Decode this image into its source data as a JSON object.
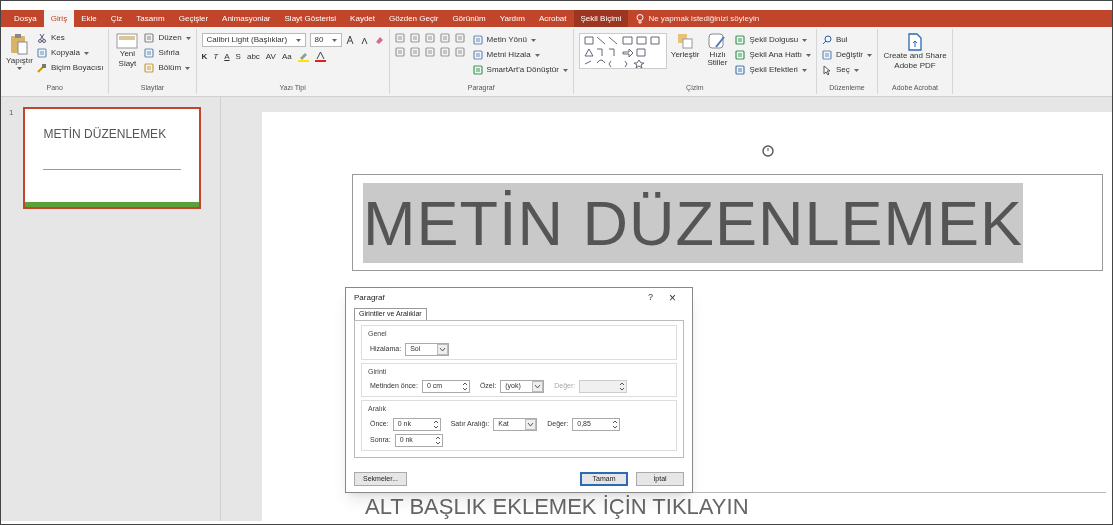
{
  "tabs": [
    {
      "label": "Dosya",
      "selected": false,
      "kind": "normal"
    },
    {
      "label": "Giriş",
      "selected": true,
      "kind": "normal"
    },
    {
      "label": "Ekle",
      "selected": false,
      "kind": "normal"
    },
    {
      "label": "Çiz",
      "selected": false,
      "kind": "normal"
    },
    {
      "label": "Tasarım",
      "selected": false,
      "kind": "normal"
    },
    {
      "label": "Geçişler",
      "selected": false,
      "kind": "normal"
    },
    {
      "label": "Animasyonlar",
      "selected": false,
      "kind": "normal"
    },
    {
      "label": "Slayt Gösterisi",
      "selected": false,
      "kind": "normal"
    },
    {
      "label": "Kaydet",
      "selected": false,
      "kind": "normal"
    },
    {
      "label": "Gözden Geçir",
      "selected": false,
      "kind": "normal"
    },
    {
      "label": "Görünüm",
      "selected": false,
      "kind": "normal"
    },
    {
      "label": "Yardım",
      "selected": false,
      "kind": "normal"
    },
    {
      "label": "Acrobat",
      "selected": false,
      "kind": "normal"
    },
    {
      "label": "Şekil Biçimi",
      "selected": false,
      "kind": "contextual"
    }
  ],
  "tell_me": {
    "placeholder": "Ne yapmak istediğinizi söyleyin"
  },
  "ribbon": [
    {
      "kind": "clipboard",
      "label": "Pano",
      "items": [
        "Yapıştır",
        "Kes",
        "Kopyala",
        "Biçim Boyacısı"
      ]
    },
    {
      "kind": "slides",
      "label": "Slaytlar",
      "items": [
        "Yeni Slayt",
        "Düzen",
        "Sıfırla",
        "Bölüm"
      ]
    },
    {
      "kind": "font",
      "label": "Yazı Tipi",
      "font": "Calibri Light (Başlıklar)",
      "size": "80",
      "items": [
        "K",
        "T",
        "A",
        "S",
        "abc",
        "AV",
        "Aa"
      ]
    },
    {
      "kind": "paragraph",
      "label": "Paragraf",
      "items": [
        "Metin Yönü",
        "Metni Hizala",
        "SmartArt'a Dönüştür"
      ]
    },
    {
      "kind": "drawing",
      "label": "Çizim",
      "items": [
        "Yerleştir",
        "Hızlı Stiller",
        "Şekil Dolgusu",
        "Şekil Ana Hattı",
        "Şekil Efektleri"
      ]
    },
    {
      "kind": "editing",
      "label": "Düzenleme",
      "items": [
        "Bul",
        "Değiştir",
        "Seç"
      ]
    },
    {
      "kind": "acrobat",
      "label": "Adobe Acrobat",
      "items": [
        "Create and Share Adobe PDF"
      ]
    }
  ],
  "thumbnails": [
    {
      "number": "1",
      "title": "METİN DÜZENLEMEK",
      "selected": true
    }
  ],
  "slide": {
    "title": "METİN DÜZENLEMEK",
    "subtitle": "ALT BAŞLIK EKLEMEK İÇİN TIKLAYIN"
  },
  "dialog": {
    "title": "Paragraf",
    "help": "?",
    "close": "×",
    "tabs": [
      {
        "label": "Girintiler ve Aralıklar",
        "selected": true
      }
    ],
    "sections": [
      {
        "title": "Genel",
        "rows": [
          [
            {
              "label": "Hizalama:",
              "kind": "dropdown",
              "value": "Sol",
              "disabled": false
            }
          ]
        ]
      },
      {
        "title": "Girinti",
        "rows": [
          [
            {
              "label": "Metinden önce:",
              "kind": "spin",
              "value": "0 cm",
              "disabled": false
            },
            {
              "label": "Özel:",
              "kind": "dropdown",
              "value": "(yok)",
              "disabled": false
            },
            {
              "label": "Değer:",
              "kind": "spin",
              "disabled": true
            }
          ]
        ]
      },
      {
        "title": "Aralık",
        "rows": [
          [
            {
              "label": "Önce:",
              "kind": "spin",
              "value": "0 nk",
              "disabled": false
            },
            {
              "label": "Satır Aralığı:",
              "kind": "dropdown",
              "value": "Kat",
              "disabled": false
            },
            {
              "label": "Değer:",
              "kind": "spin",
              "value": "0,85",
              "disabled": false
            }
          ],
          [
            {
              "label": "Sonra:",
              "kind": "spin",
              "value": "0 nk",
              "disabled": false
            }
          ]
        ]
      }
    ],
    "buttons": [
      {
        "label": "Sekmeler...",
        "default": false
      },
      {
        "label": "Tamam",
        "default": true
      },
      {
        "label": "İptal",
        "default": false
      }
    ]
  }
}
